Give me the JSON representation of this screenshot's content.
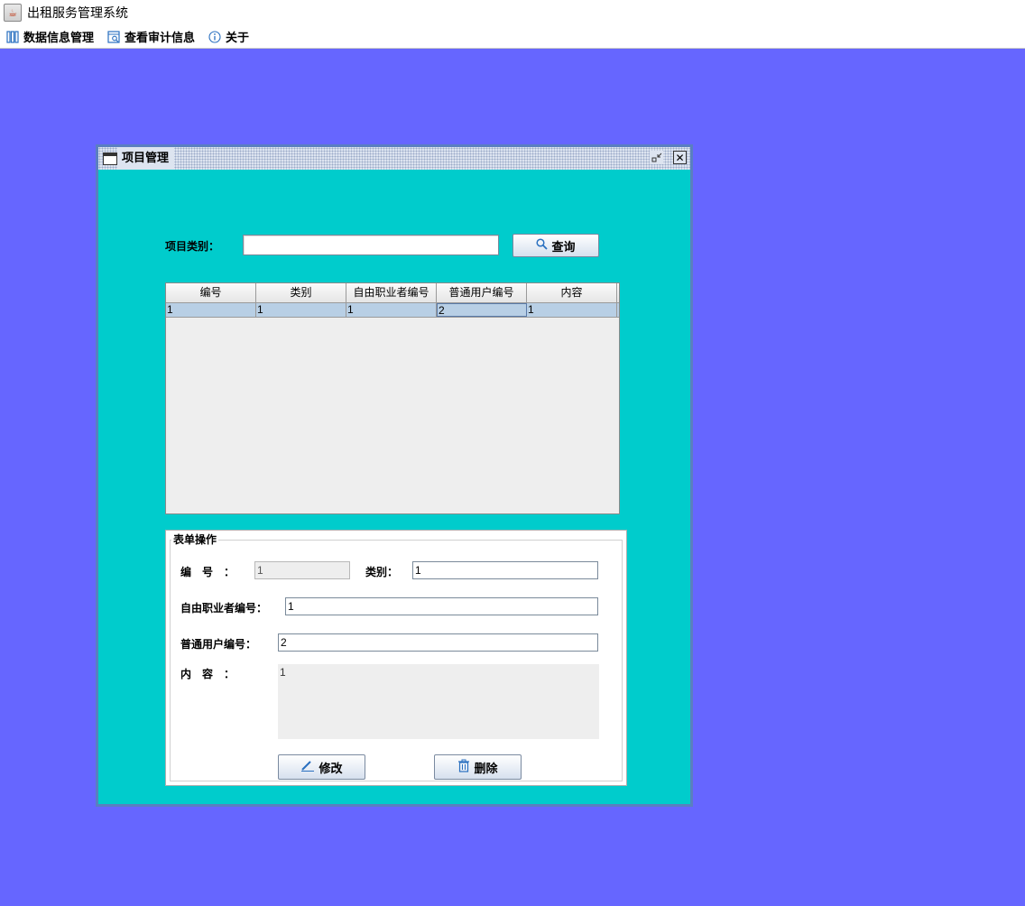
{
  "window": {
    "title": "出租服务管理系统",
    "icon": "java-icon"
  },
  "menubar": {
    "items": [
      {
        "label": "数据信息管理",
        "icon": "database-icon"
      },
      {
        "label": "查看审计信息",
        "icon": "audit-icon"
      },
      {
        "label": "关于",
        "icon": "info-icon"
      }
    ]
  },
  "colors": {
    "desktop": "#6666ff",
    "frame_bg": "#00cccc",
    "selected_row": "#b8cfe5"
  },
  "internal_frame": {
    "title": "项目管理",
    "search": {
      "label": "项目类别：",
      "value": "",
      "button": "查询"
    },
    "table": {
      "columns": [
        "编号",
        "类别",
        "自由职业者编号",
        "普通用户编号",
        "内容"
      ],
      "rows": [
        [
          "1",
          "1",
          "1",
          "2",
          "1"
        ]
      ]
    },
    "form": {
      "legend": "表单操作",
      "id_label": "编　号　：",
      "id_value": "1",
      "category_label": "类别：",
      "category_value": "1",
      "freelancer_label": "自由职业者编号：",
      "freelancer_value": "1",
      "user_label": "普通用户编号：",
      "user_value": "2",
      "content_label": "内　容　：",
      "content_value": "1",
      "edit_button": "修改",
      "delete_button": "删除"
    }
  }
}
